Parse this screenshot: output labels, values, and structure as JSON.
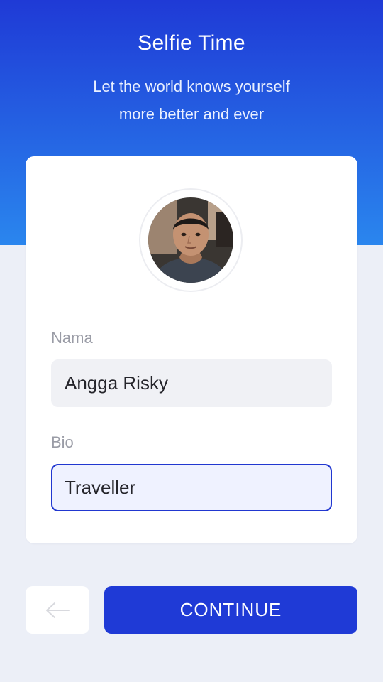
{
  "header": {
    "title": "Selfie Time",
    "subtitle_line1": "Let the world knows yourself",
    "subtitle_line2": "more better and ever"
  },
  "form": {
    "name_label": "Nama",
    "name_value": "Angga Risky",
    "bio_label": "Bio",
    "bio_value": "Traveller"
  },
  "actions": {
    "back_icon": "arrow-left-icon",
    "continue_label": "CONTINUE"
  },
  "colors": {
    "primary": "#1F3AD6",
    "gradient_bottom": "#2A86EE",
    "background": "#ECEFF7",
    "field_focus_bg": "#EFF2FF"
  }
}
